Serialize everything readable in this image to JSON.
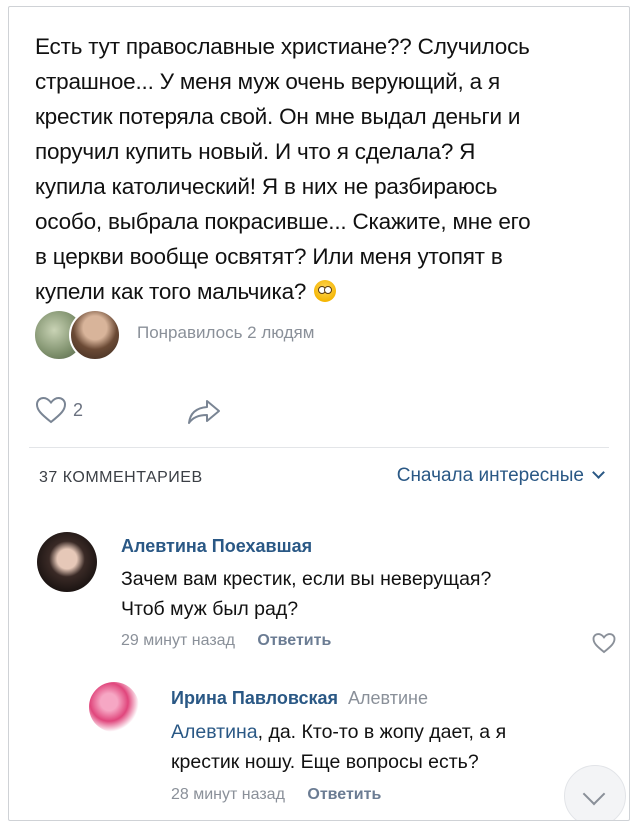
{
  "post": {
    "text_lines": [
      "Есть тут православные христиане?? Случилось",
      "страшное... У меня муж очень верующий, а я",
      "крестик потеряла свой. Он мне выдал деньги и",
      "поручил купить новый. И что я сделала? Я",
      "купила католический! Я в них не разбираюсь",
      "особо, выбрала покрасивше... Скажите, мне его",
      "в церкви вообще освятят? Или меня утопят в",
      "купели как того мальчика?"
    ],
    "emoji": "flushed-face-icon",
    "likes_text": "Понравилось 2 людям",
    "like_count": "2"
  },
  "comments_section": {
    "header": "37 КОММЕНТАРИЕВ",
    "sort_label": "Сначала интересные"
  },
  "comments": [
    {
      "author": "Алевтина Поехавшая",
      "text_lines": [
        "Зачем вам крестик, если вы неверущая?",
        "Чтоб муж был рад?"
      ],
      "time": "29 минут назад",
      "reply_label": "Ответить"
    },
    {
      "author": "Ирина Павловская",
      "reply_to": "Алевтине",
      "mention": "Алевтина",
      "text_first_rest": ", да. Кто-то в жопу дает, а я",
      "text_second": "крестик ношу. Еще вопросы есть?",
      "time": "28 минут назад",
      "reply_label": "Ответить"
    }
  ],
  "colors": {
    "link": "#2a5885",
    "muted": "#8a9099",
    "text": "#111111"
  }
}
